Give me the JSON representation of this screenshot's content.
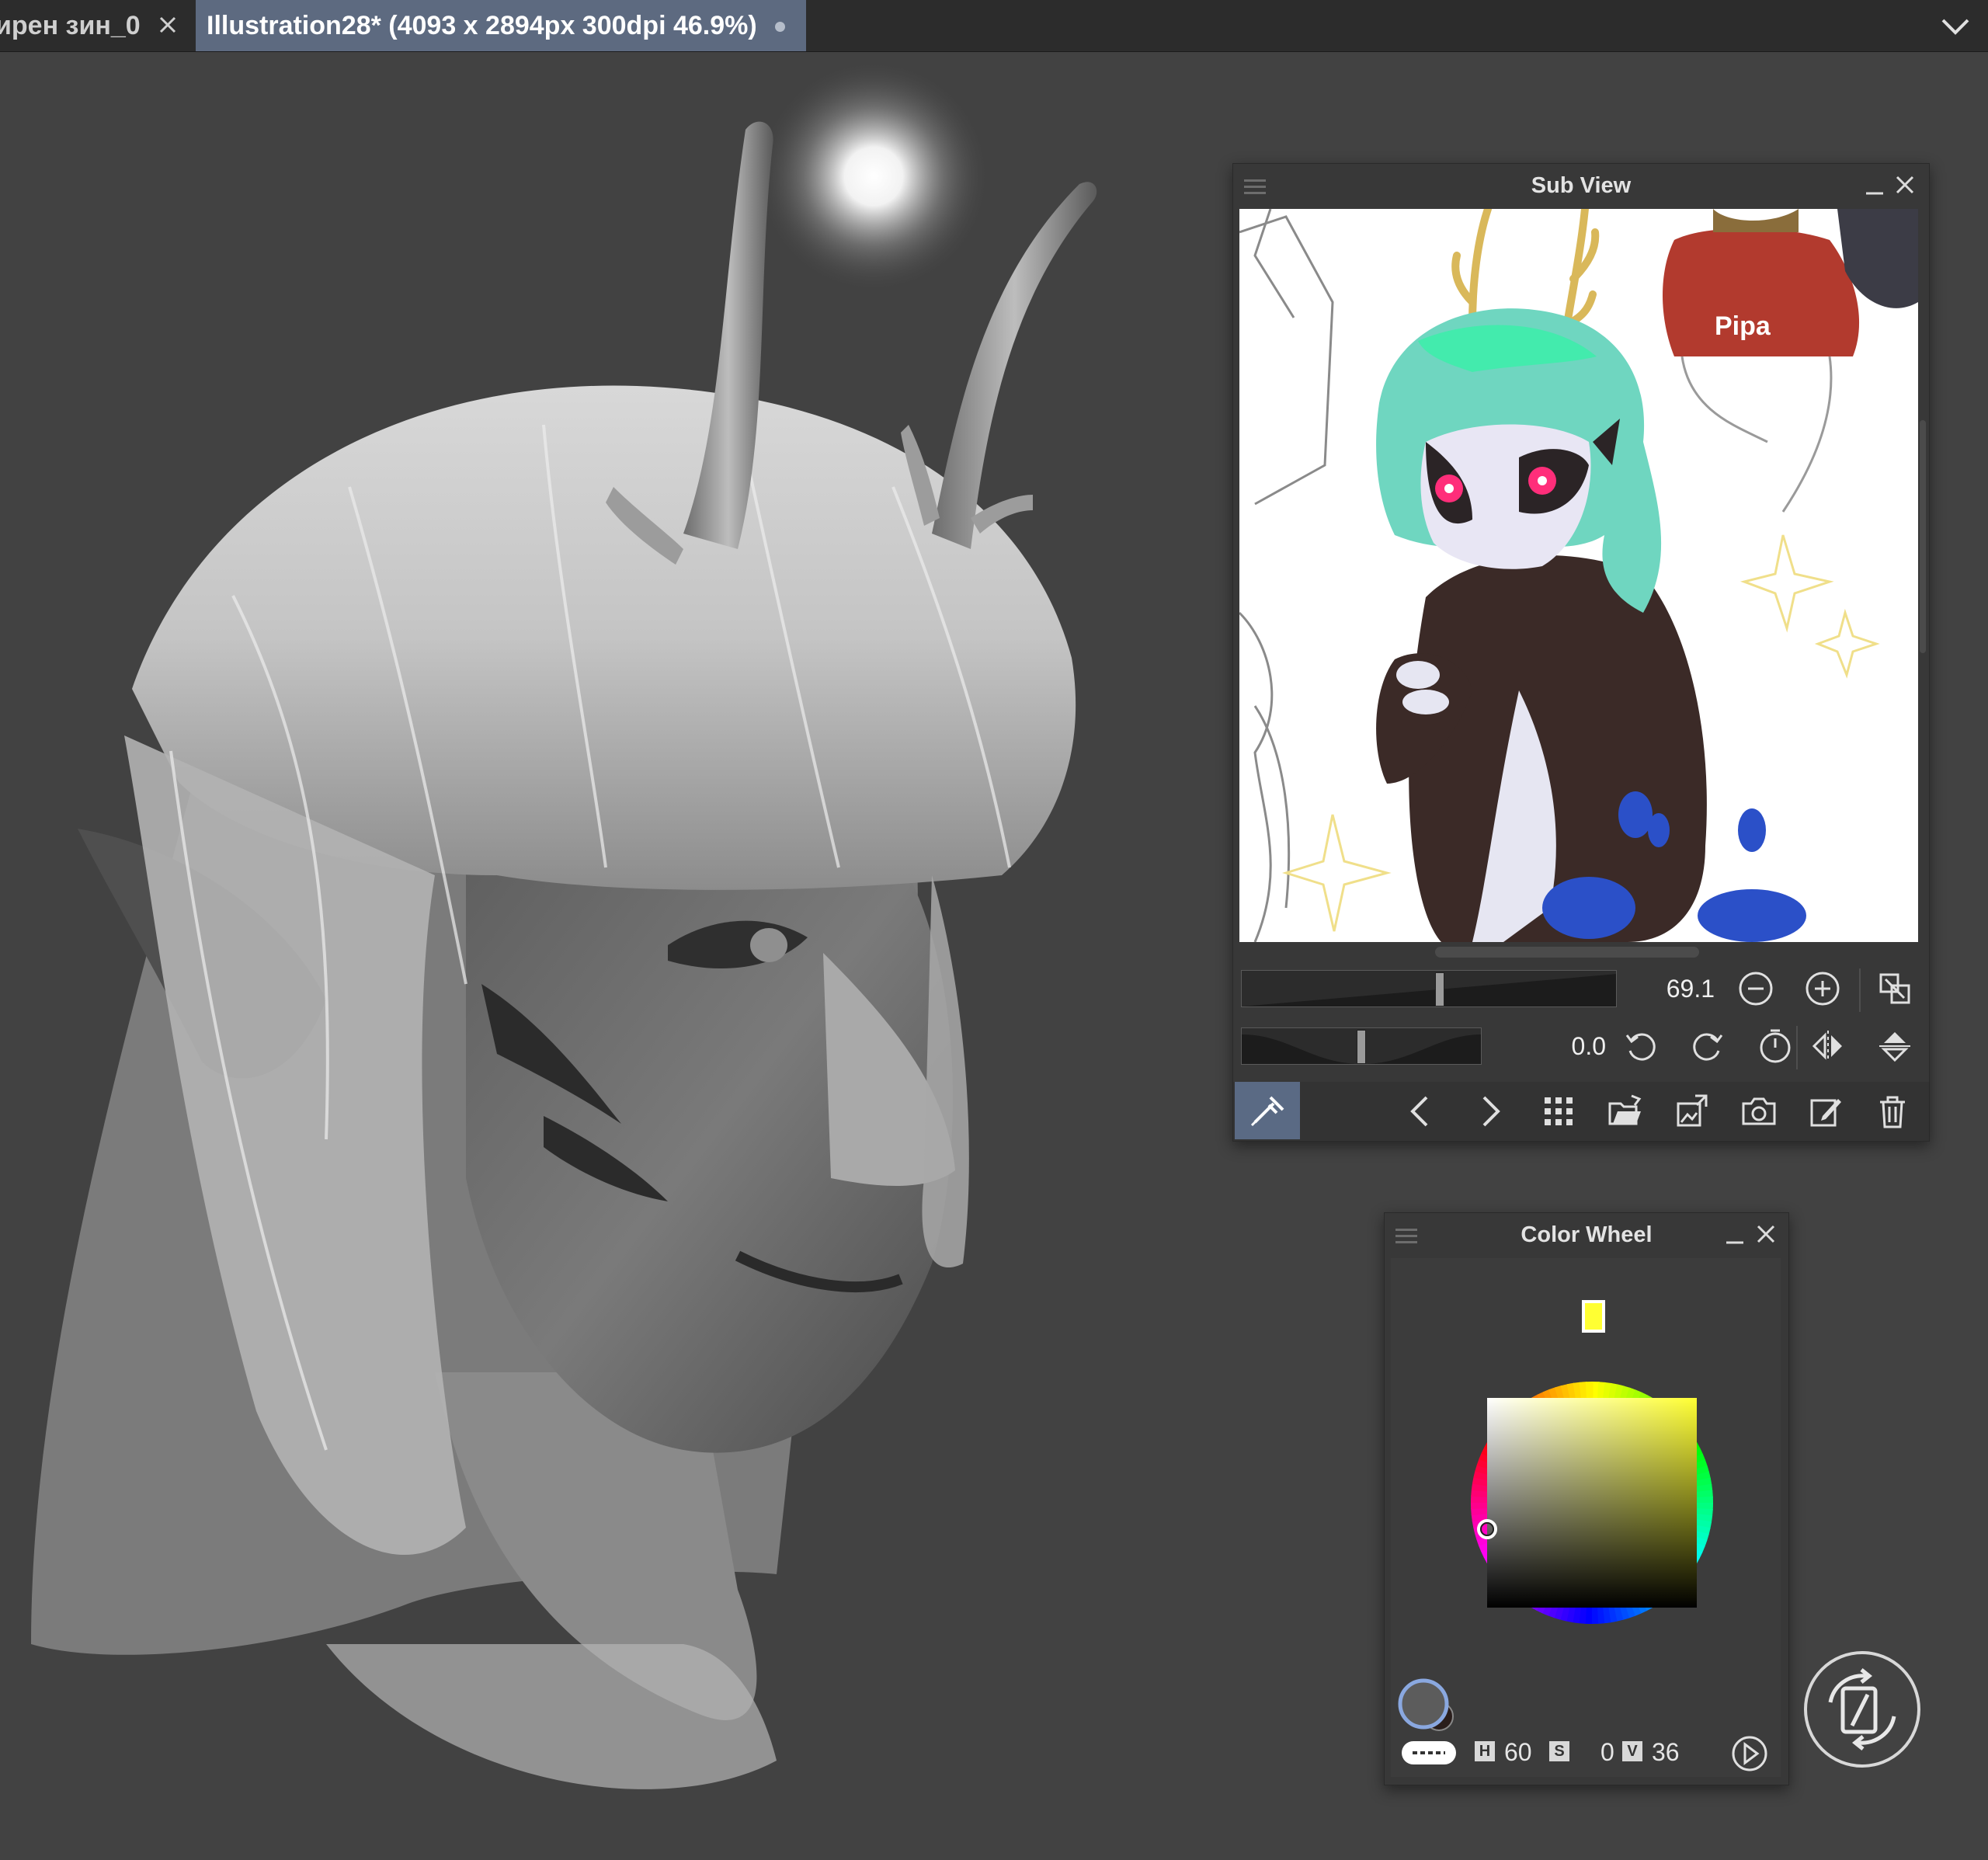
{
  "tabs": [
    {
      "label": "ирен зин_0",
      "active": false
    },
    {
      "label": "Illustration28* (4093 x 2894px 300dpi 46.9%)",
      "active": true
    }
  ],
  "icons": {
    "tab_close": "close-icon",
    "tab_menu": "chevron-down-icon",
    "unsaved": "unsaved-dot-icon"
  },
  "sub_view": {
    "title": "Sub View",
    "zoom_value": "69.1",
    "zoom_level": 0.53,
    "rotation_value": "0.0",
    "rotation_level": 0.5,
    "sketch_text": "Pipa"
  },
  "color_wheel": {
    "title": "Color Wheel",
    "h_label": "H",
    "h_value": "60",
    "s_label": "S",
    "s_value": "0",
    "v_label": "V",
    "v_value": "36",
    "hue_color": "#ffff33"
  },
  "colors": {
    "canvas_bg": "#424242",
    "active_tab": "#5d6a80",
    "panel_bg": "#383838"
  }
}
